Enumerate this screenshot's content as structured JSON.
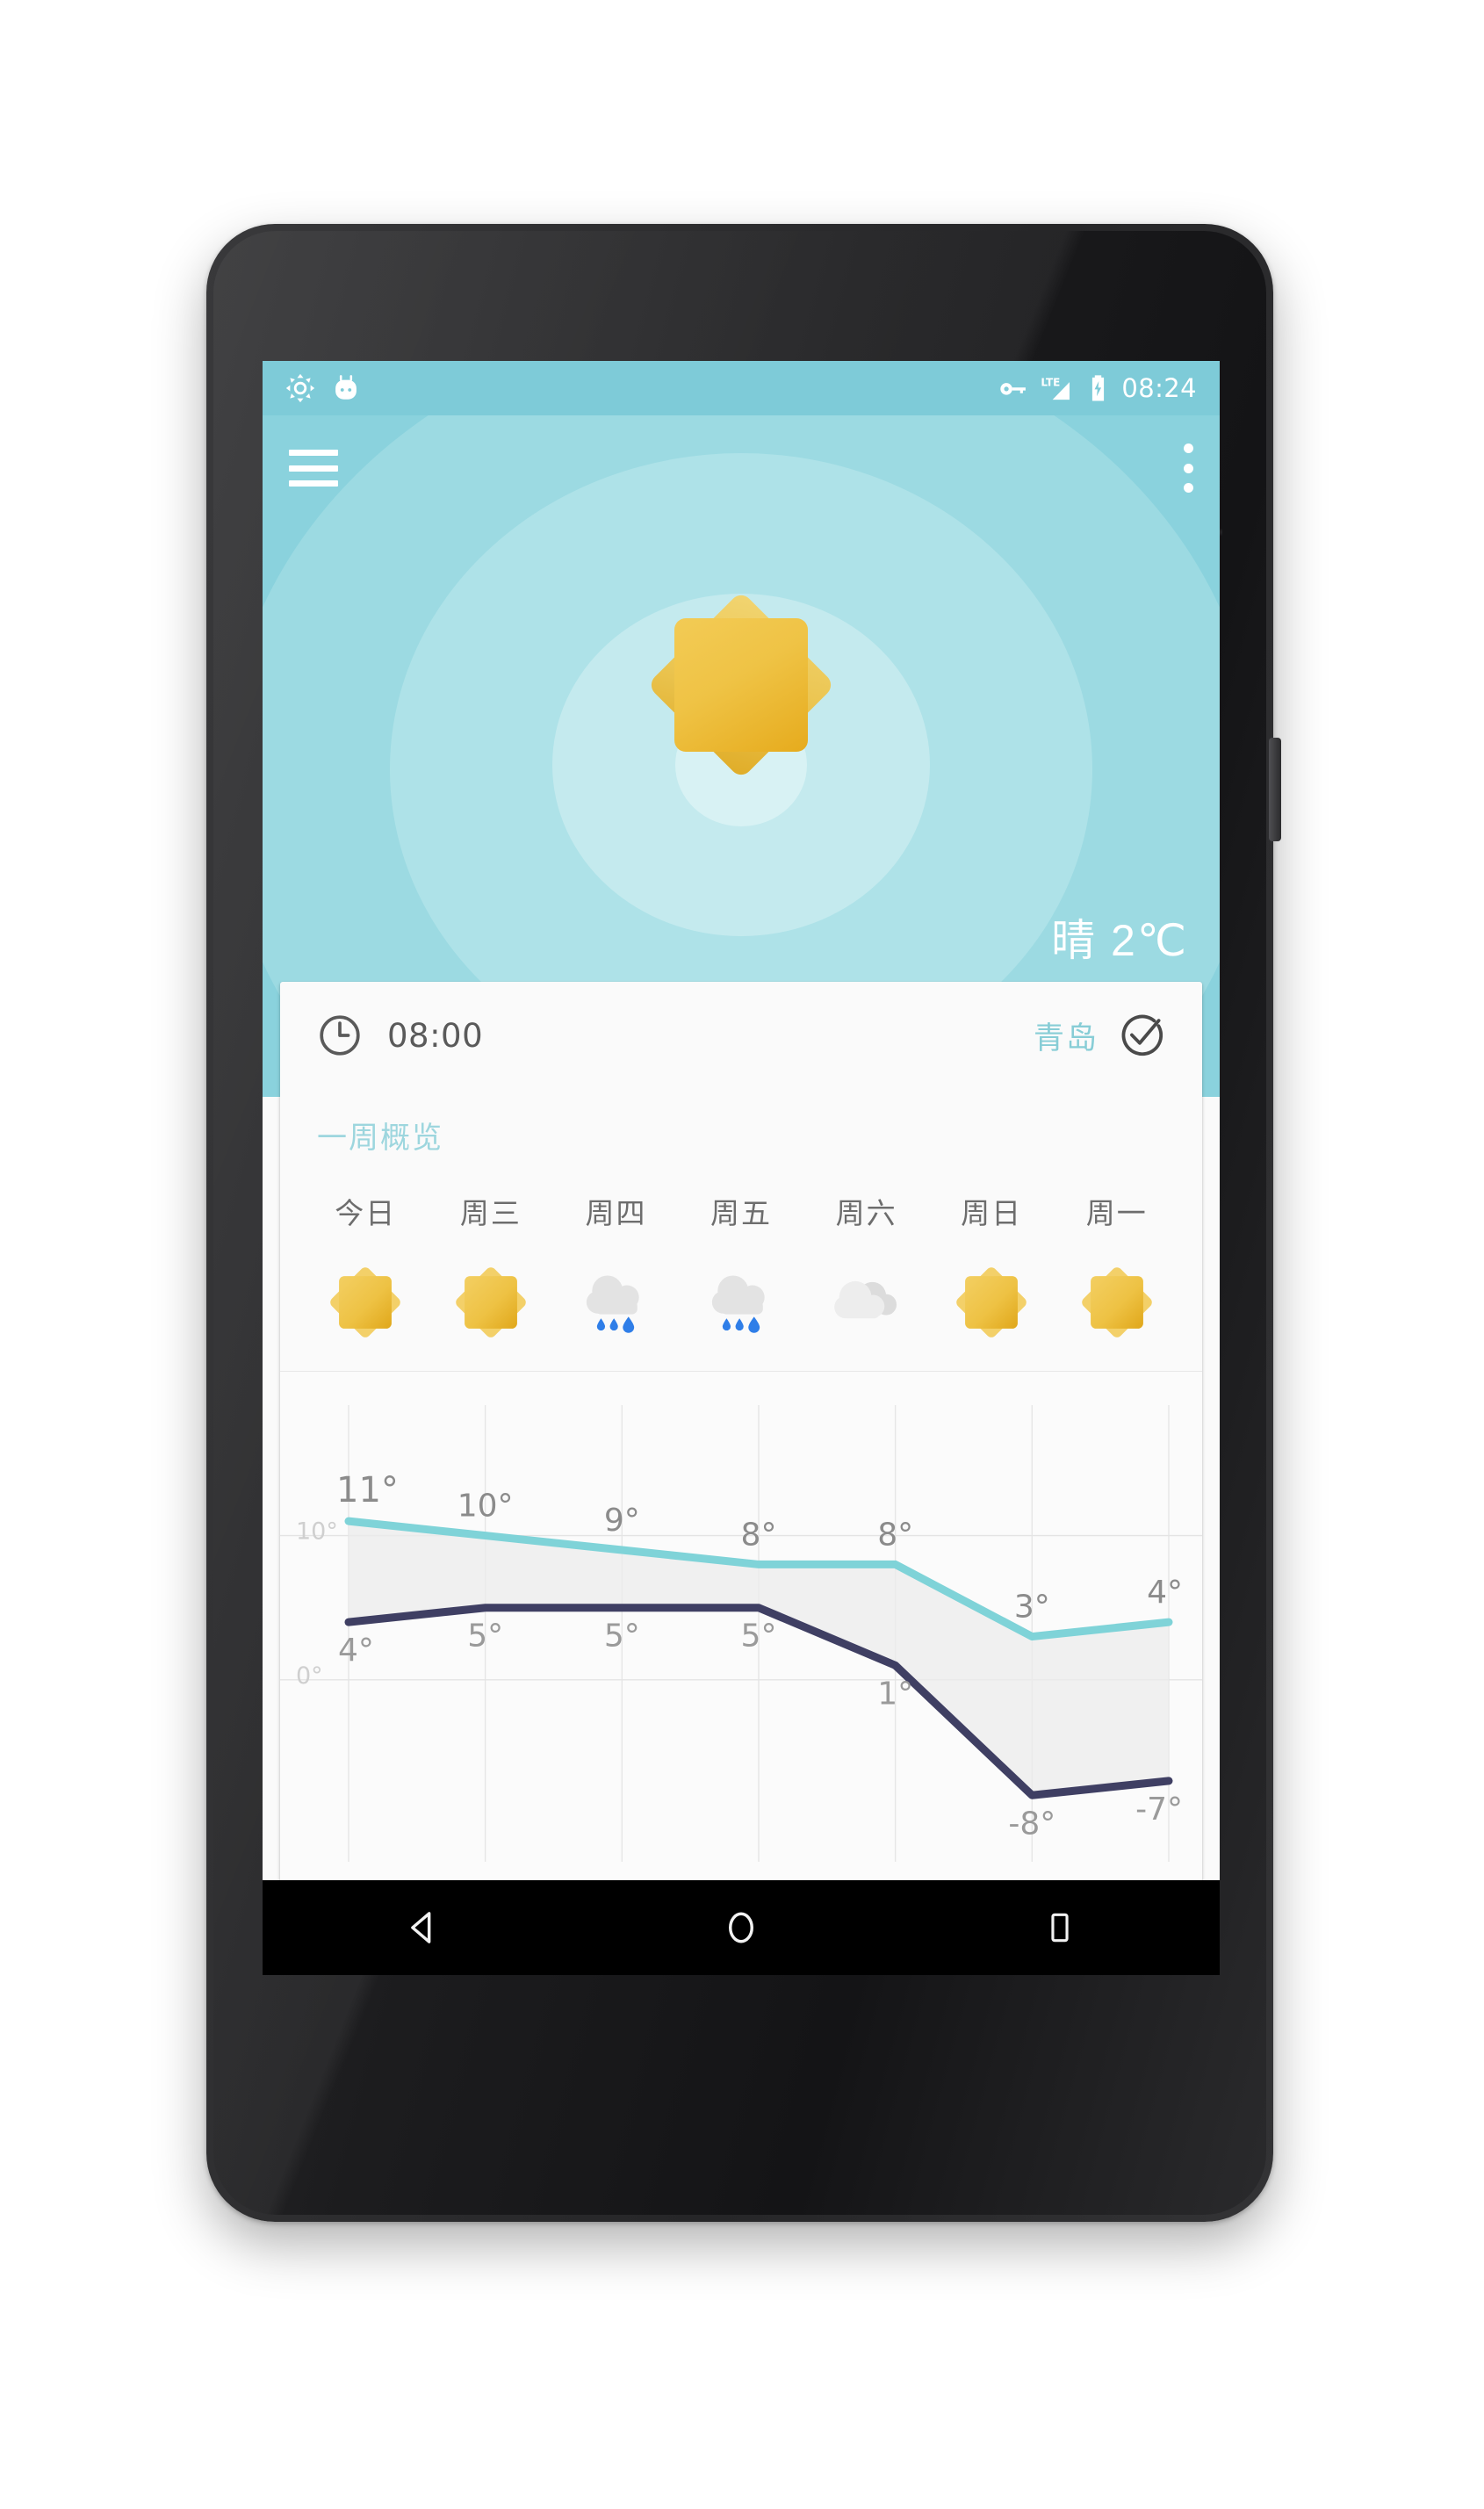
{
  "device": {
    "model_style": "android-phone"
  },
  "status_bar": {
    "icons_left": [
      "brightness-auto-icon",
      "android-marshmallow-icon"
    ],
    "icons_right": [
      "vpn-key-icon",
      "lte-signal-icon",
      "battery-charging-icon"
    ],
    "network_label": "LTE",
    "clock": "08:24"
  },
  "app_bar": {
    "menu_label": "menu-icon",
    "overflow_label": "overflow-menu-icon"
  },
  "hero": {
    "weather_icon": "sun-icon",
    "condition_text": "晴 2℃",
    "background_color": "#7ecbd8"
  },
  "card": {
    "clock_icon": "clock-icon",
    "time": "08:00",
    "city": "青岛",
    "confirm_icon": "check-circle-icon",
    "section_title": "一周概览",
    "accent_color": "#9dd6de",
    "days": [
      {
        "label": "今日",
        "icon": "sunny"
      },
      {
        "label": "周三",
        "icon": "sunny"
      },
      {
        "label": "周四",
        "icon": "rain"
      },
      {
        "label": "周五",
        "icon": "rain"
      },
      {
        "label": "周六",
        "icon": "cloudy"
      },
      {
        "label": "周日",
        "icon": "sunny"
      },
      {
        "label": "周一",
        "icon": "sunny"
      }
    ]
  },
  "chart_data": {
    "type": "line",
    "title": "一周概览",
    "categories": [
      "今日",
      "周三",
      "周四",
      "周五",
      "周六",
      "周日",
      "周一"
    ],
    "series": [
      {
        "name": "high",
        "values": [
          11,
          10,
          9,
          8,
          8,
          3,
          4
        ],
        "labels": [
          "11°",
          "10°",
          "9°",
          "8°",
          "8°",
          "3°",
          "4°"
        ],
        "color": "#7fd3d8"
      },
      {
        "name": "low",
        "values": [
          4,
          5,
          5,
          5,
          1,
          -8,
          -7
        ],
        "labels": [
          "4°",
          "5°",
          "5°",
          "5°",
          "1°",
          "-8°",
          "-7°"
        ],
        "color": "#3f3f63"
      }
    ],
    "ylim": [
      -12,
      16
    ],
    "yticks": [
      10,
      0
    ],
    "ytick_labels": [
      "10°",
      "0°"
    ],
    "xlabel": "",
    "ylabel": "",
    "grid": true,
    "legend": "none",
    "fill_between": "#ececec"
  },
  "nav_bar": {
    "buttons": [
      {
        "name": "back-button",
        "icon": "triangle-left"
      },
      {
        "name": "home-button",
        "icon": "circle"
      },
      {
        "name": "recents-button",
        "icon": "square"
      }
    ]
  }
}
